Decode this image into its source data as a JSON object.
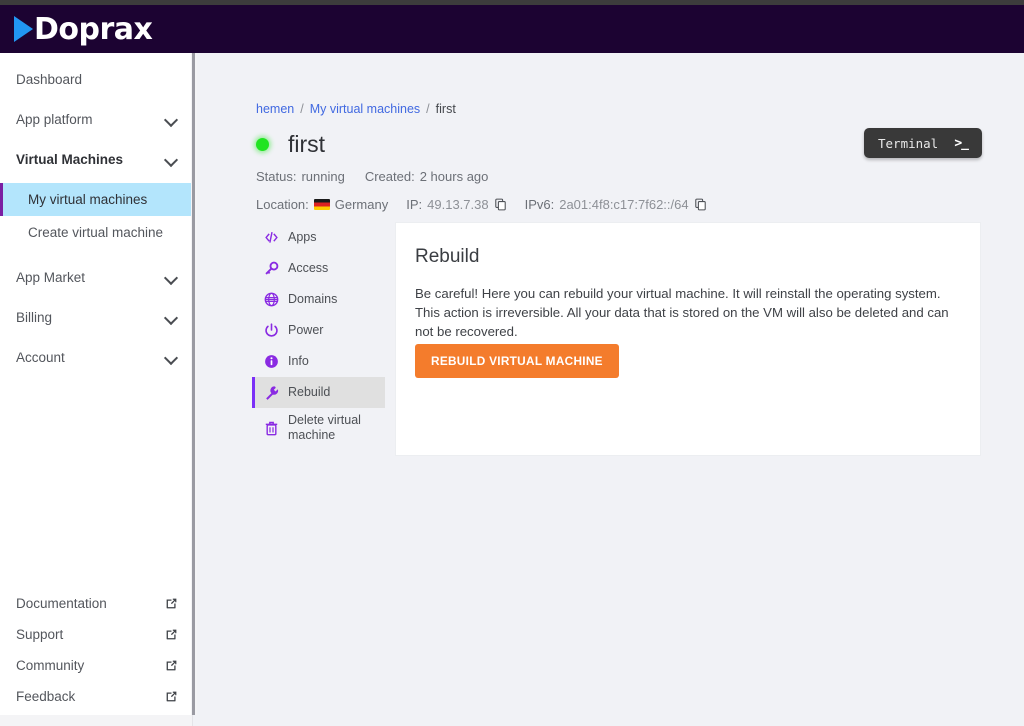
{
  "brand": {
    "name": "Doprax",
    "logo_icon": "play-triangle-icon"
  },
  "sidebar": {
    "top_items": [
      {
        "label": "Dashboard",
        "expandable": false,
        "bold": false,
        "sub": false,
        "active": false
      },
      {
        "label": "App platform",
        "expandable": true,
        "bold": false,
        "sub": false,
        "active": false
      },
      {
        "label": "Virtual Machines",
        "expandable": true,
        "bold": true,
        "sub": false,
        "active": false
      },
      {
        "label": "My virtual machines",
        "expandable": false,
        "bold": false,
        "sub": true,
        "active": true
      },
      {
        "label": "Create virtual machine",
        "expandable": false,
        "bold": false,
        "sub": true,
        "active": false
      },
      {
        "label": "App Market",
        "expandable": true,
        "bold": false,
        "sub": false,
        "active": false
      },
      {
        "label": "Billing",
        "expandable": true,
        "bold": false,
        "sub": false,
        "active": false
      },
      {
        "label": "Account",
        "expandable": true,
        "bold": false,
        "sub": false,
        "active": false
      }
    ],
    "bottom_items": [
      {
        "label": "Documentation",
        "icon": "external-link-icon"
      },
      {
        "label": "Support",
        "icon": "external-link-icon"
      },
      {
        "label": "Community",
        "icon": "external-link-icon"
      },
      {
        "label": "Feedback",
        "icon": "external-link-icon"
      }
    ]
  },
  "breadcrumb": {
    "items": [
      {
        "label": "hemen",
        "link": true
      },
      {
        "label": "My virtual machines",
        "link": true
      },
      {
        "label": "first",
        "link": false
      }
    ],
    "separator": "/"
  },
  "vm": {
    "name": "first",
    "status_dot": "status-running-dot",
    "status_label": "Status:",
    "status_value": "running",
    "created_label": "Created:",
    "created_value": "2 hours ago",
    "location_label": "Location:",
    "location_value": "Germany",
    "location_flag": "flag-germany-icon",
    "ip_label": "IP:",
    "ip_value": "49.13.7.38",
    "ipv6_label": "IPv6:",
    "ipv6_value": "2a01:4f8:c17:7f62::/64",
    "copy_icon": "copy-icon"
  },
  "terminal_button": {
    "label": "Terminal",
    "glyph": ">_",
    "icon": "terminal-prompt-icon"
  },
  "subnav": {
    "items": [
      {
        "label": "Apps",
        "icon": "code-brackets-icon",
        "active": false
      },
      {
        "label": "Access",
        "icon": "key-icon",
        "active": false
      },
      {
        "label": "Domains",
        "icon": "globe-icon",
        "active": false
      },
      {
        "label": "Power",
        "icon": "power-icon",
        "active": false
      },
      {
        "label": "Info",
        "icon": "info-circle-icon",
        "active": false
      },
      {
        "label": "Rebuild",
        "icon": "wrench-icon",
        "active": true
      },
      {
        "label": "Delete virtual machine",
        "icon": "trash-icon",
        "active": false
      }
    ]
  },
  "card": {
    "title": "Rebuild",
    "description": "Be careful! Here you can rebuild your virtual machine. It will reinstall the operating system. This action is irreversible. All your data that is stored on the VM will also be deleted and can not be recovered.",
    "button_label": "REBUILD VIRTUAL MACHINE"
  },
  "colors": {
    "header_bg": "#1c0332",
    "accent_purple": "#7b2ff7",
    "active_nav_bg": "#b3e5fc",
    "link_blue": "#4169e1",
    "danger_orange": "#f47c2c",
    "status_green": "#21e421",
    "page_bg": "#f1f2f6"
  }
}
